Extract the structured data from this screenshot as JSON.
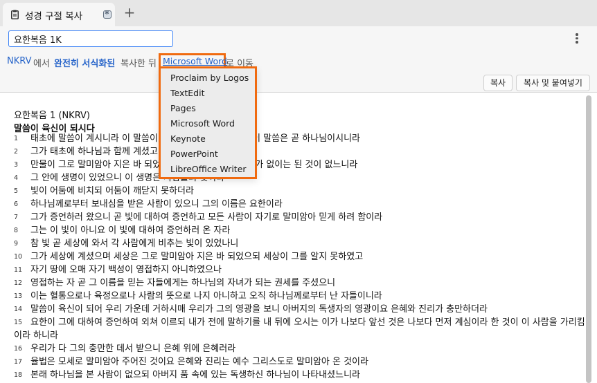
{
  "tab": {
    "title": "성경 구절 복사",
    "new_tab_label": "+"
  },
  "search": {
    "value": "요한복음 1K"
  },
  "info": {
    "version": "NKRV",
    "text_in": "에서",
    "format_link": "완전히 서식화된",
    "text_copy": "복사한 뒤",
    "target_app": "Microsoft Word",
    "text_move": "로 이동"
  },
  "buttons": {
    "copy": "복사",
    "copy_paste": "복사 및 붙여넣기"
  },
  "menu": {
    "items": [
      "Proclaim by Logos",
      "TextEdit",
      "Pages",
      "Microsoft Word",
      "Keynote",
      "PowerPoint",
      "LibreOffice Writer"
    ]
  },
  "passage": {
    "reference": "요한복음 1 (NKRV)",
    "heading": "말씀이 육신이 되시다",
    "verses": [
      {
        "n": "1",
        "text": "태초에 말씀이 계시니라 이 말씀이 하나님과 함께 계셨으니 이 말씀은 곧 하나님이시니라"
      },
      {
        "n": "2",
        "text": "그가 태초에 하나님과 함께 계셨고"
      },
      {
        "n": "3",
        "text": "만물이 그로 말미암아 지은 바 되었으니 지은 것이 하나도 그가 없이는 된 것이 없느니라"
      },
      {
        "n": "4",
        "text": "그 안에 생명이 있었으니 이 생명은 사람들의 빛이라"
      },
      {
        "n": "5",
        "text": "빛이 어둠에 비치되 어둠이 깨닫지 못하더라"
      },
      {
        "n": "6",
        "text": "하나님께로부터 보내심을 받은 사람이 있으니 그의 이름은 요한이라"
      },
      {
        "n": "7",
        "text": "그가 증언하러 왔으니 곧 빛에 대하여 증언하고 모든 사람이 자기로 말미암아 믿게 하려 함이라"
      },
      {
        "n": "8",
        "text": "그는 이 빛이 아니요 이 빛에 대하여 증언하러 온 자라"
      },
      {
        "n": "9",
        "text": "참 빛 곧 세상에 와서 각 사람에게 비추는 빛이 있었나니"
      },
      {
        "n": "10",
        "text": "그가 세상에 계셨으며 세상은 그로 말미암아 지은 바 되었으되 세상이 그를 알지 못하였고"
      },
      {
        "n": "11",
        "text": "자기 땅에 오매 자기 백성이 영접하지 아니하였으나"
      },
      {
        "n": "12",
        "text": "영접하는 자 곧 그 이름을 믿는 자들에게는 하나님의 자녀가 되는 권세를 주셨으니"
      },
      {
        "n": "13",
        "text": "이는 혈통으로나 육정으로나 사람의 뜻으로 나지 아니하고 오직 하나님께로부터 난 자들이니라"
      },
      {
        "n": "14",
        "text": "말씀이 육신이 되어 우리 가운데 거하시매 우리가 그의 영광을 보니 아버지의 독생자의 영광이요 은혜와 진리가 충만하더라"
      },
      {
        "n": "15",
        "text": "요한이 그에 대하여 증언하여 외쳐 이르되 내가 전에 말하기를 내 뒤에 오시는 이가 나보다 앞선 것은 나보다 먼저 계심이라 한 것이 이 사람을 가리킴이라 하니라"
      },
      {
        "n": "16",
        "text": "우리가 다 그의 충만한 데서 받으니 은혜 위에 은혜러라"
      },
      {
        "n": "17",
        "text": "율법은 모세로 말미암아 주어진 것이요 은혜와 진리는 예수 그리스도로 말미암아 온 것이라"
      },
      {
        "n": "18",
        "text": "본래 하나님을 본 사람이 없으되 아버지 품 속에 있는 독생하신 하나님이 나타내셨느니라"
      }
    ]
  }
}
